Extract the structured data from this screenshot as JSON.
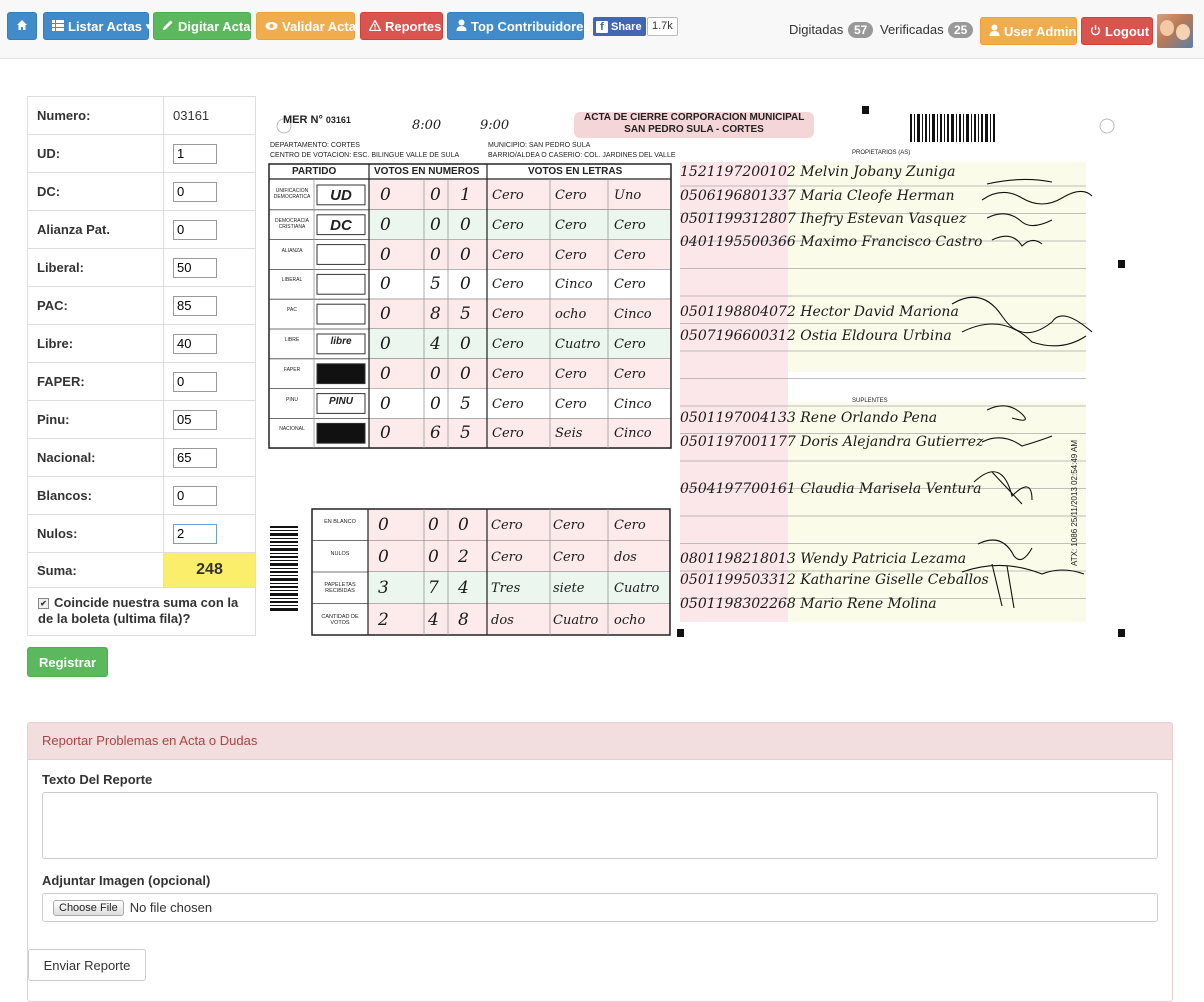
{
  "navbar": {
    "home_label": "",
    "listar_label": "Listar Actas",
    "digitar_label": "Digitar Acta",
    "validar_label": "Validar Acta",
    "reportes_label": "Reportes",
    "top_label": "Top Contribuidores",
    "share_label": "Share",
    "share_count": "1.7k",
    "digitadas_label": "Digitadas",
    "digitadas_count": "57",
    "verificadas_label": "Verificadas",
    "verificadas_count": "25",
    "user_label": "User Admin",
    "logout_label": "Logout"
  },
  "form": {
    "numero_label": "Numero:",
    "numero_value": "03161",
    "fields": [
      {
        "label": "UD:",
        "value": "1"
      },
      {
        "label": "DC:",
        "value": "0"
      },
      {
        "label": "Alianza Pat.",
        "value": "0"
      },
      {
        "label": "Liberal:",
        "value": "50"
      },
      {
        "label": "PAC:",
        "value": "85"
      },
      {
        "label": "Libre:",
        "value": "40"
      },
      {
        "label": "FAPER:",
        "value": "0"
      },
      {
        "label": "Pinu:",
        "value": "05"
      },
      {
        "label": "Nacional:",
        "value": "65"
      },
      {
        "label": "Blancos:",
        "value": "0"
      },
      {
        "label": "Nulos:",
        "value": "2"
      }
    ],
    "suma_label": "Suma:",
    "suma_value": "248",
    "coincide_label": "Coincide nuestra suma con la de la boleta (ultima fila)?",
    "coincide_checked": true,
    "registrar_label": "Registrar"
  },
  "acta": {
    "mer_label": "MER N°",
    "mer_number": "03161",
    "title_line1": "ACTA DE CIERRE CORPORACION MUNICIPAL",
    "title_line2": "SAN PEDRO SULA - CORTES",
    "hora_inicio": "8:00",
    "hora_cierre": "9:00",
    "departamento": "DEPARTAMENTO: CORTES",
    "centro": "CENTRO DE VOTACION: ESC. BILINGUE VALLE DE SULA",
    "municipio": "MUNICIPIO: SAN PEDRO SULA",
    "barrio": "BARRIO/ALDEA O CASERIO: COL. JARDINES DEL VALLE",
    "col_partido": "PARTIDO",
    "col_numeros": "VOTOS EN NUMEROS",
    "col_letras": "VOTOS EN LETRAS",
    "propietarios": "PROPIETARIOS (AS)",
    "suplentes": "SUPLENTES",
    "parties": [
      {
        "name": "UNIFICACION DEMOCRATICA",
        "logo": "UD",
        "digits": [
          "0",
          "0",
          "1"
        ],
        "words": [
          "Cero",
          "Cero",
          "Uno"
        ],
        "color": "#fdeaea"
      },
      {
        "name": "DEMOCRACIA CRISTIANA",
        "logo": "DC",
        "digits": [
          "0",
          "0",
          "0"
        ],
        "words": [
          "Cero",
          "Cero",
          "Cero"
        ],
        "color": "#eaf6ee"
      },
      {
        "name": "ALIANZA",
        "logo": "",
        "digits": [
          "0",
          "0",
          "0"
        ],
        "words": [
          "Cero",
          "Cero",
          "Cero"
        ],
        "color": "#fdeaea"
      },
      {
        "name": "LIBERAL",
        "logo": "",
        "digits": [
          "0",
          "5",
          "0"
        ],
        "words": [
          "Cero",
          "Cinco",
          "Cero"
        ],
        "color": "#fff"
      },
      {
        "name": "PAC",
        "logo": "",
        "digits": [
          "0",
          "8",
          "5"
        ],
        "words": [
          "Cero",
          "ocho",
          "Cinco"
        ],
        "color": "#fdeaea"
      },
      {
        "name": "LIBRE",
        "logo": "libre",
        "digits": [
          "0",
          "4",
          "0"
        ],
        "words": [
          "Cero",
          "Cuatro",
          "Cero"
        ],
        "color": "#eaf6ee"
      },
      {
        "name": "FAPER",
        "logo": "",
        "digits": [
          "0",
          "0",
          "0"
        ],
        "words": [
          "Cero",
          "Cero",
          "Cero"
        ],
        "color": "#fdeaea"
      },
      {
        "name": "PINU",
        "logo": "PINU",
        "digits": [
          "0",
          "0",
          "5"
        ],
        "words": [
          "Cero",
          "Cero",
          "Cinco"
        ],
        "color": "#fff"
      },
      {
        "name": "NACIONAL",
        "logo": "",
        "digits": [
          "0",
          "6",
          "5"
        ],
        "words": [
          "Cero",
          "Seis",
          "Cinco"
        ],
        "color": "#fdeaea"
      }
    ],
    "totals": [
      {
        "name": "EN BLANCO",
        "digits": [
          "0",
          "0",
          "0"
        ],
        "words": [
          "Cero",
          "Cero",
          "Cero"
        ]
      },
      {
        "name": "NULOS",
        "digits": [
          "0",
          "0",
          "2"
        ],
        "words": [
          "Cero",
          "Cero",
          "dos"
        ]
      },
      {
        "name": "PAPELETAS RECIBIDAS",
        "digits": [
          "3",
          "7",
          "4"
        ],
        "words": [
          "Tres",
          "siete",
          "Cuatro"
        ]
      },
      {
        "name": "CANTIDAD DE VOTOS",
        "digits": [
          "2",
          "4",
          "8"
        ],
        "words": [
          "dos",
          "Cuatro",
          "ocho"
        ]
      }
    ],
    "propietarios_rows": [
      "1521197200102 Melvin Jobany Zuniga",
      "0506196801337 Maria Cleofe Herman",
      "0501199312807 Ihefry Estevan Vasquez",
      "0401195500366 Maximo Francisco Castro",
      "0501198804072 Hector David Mariona",
      "0507196600312 Ostia Eldoura Urbina"
    ],
    "suplentes_rows": [
      "0501197004133 Rene Orlando Pena",
      "0501197001177 Doris Alejandra Gutierrez",
      "0504197700161 Claudia Marisela Ventura",
      "0801198218013 Wendy Patricia Lezama",
      "0501199503312 Katharine Giselle Ceballos",
      "0501198302268 Mario Rene Molina"
    ],
    "stamp": "ATX: 1086 25/11/2013 02:54:49 AM"
  },
  "report": {
    "heading": "Reportar Problemas en Acta o Dudas",
    "texto_label": "Texto Del Reporte",
    "texto_value": "",
    "adjuntar_label": "Adjuntar Imagen (opcional)",
    "choose_label": "Choose File",
    "no_file_label": "No file chosen",
    "enviar_label": "Enviar Reporte"
  }
}
